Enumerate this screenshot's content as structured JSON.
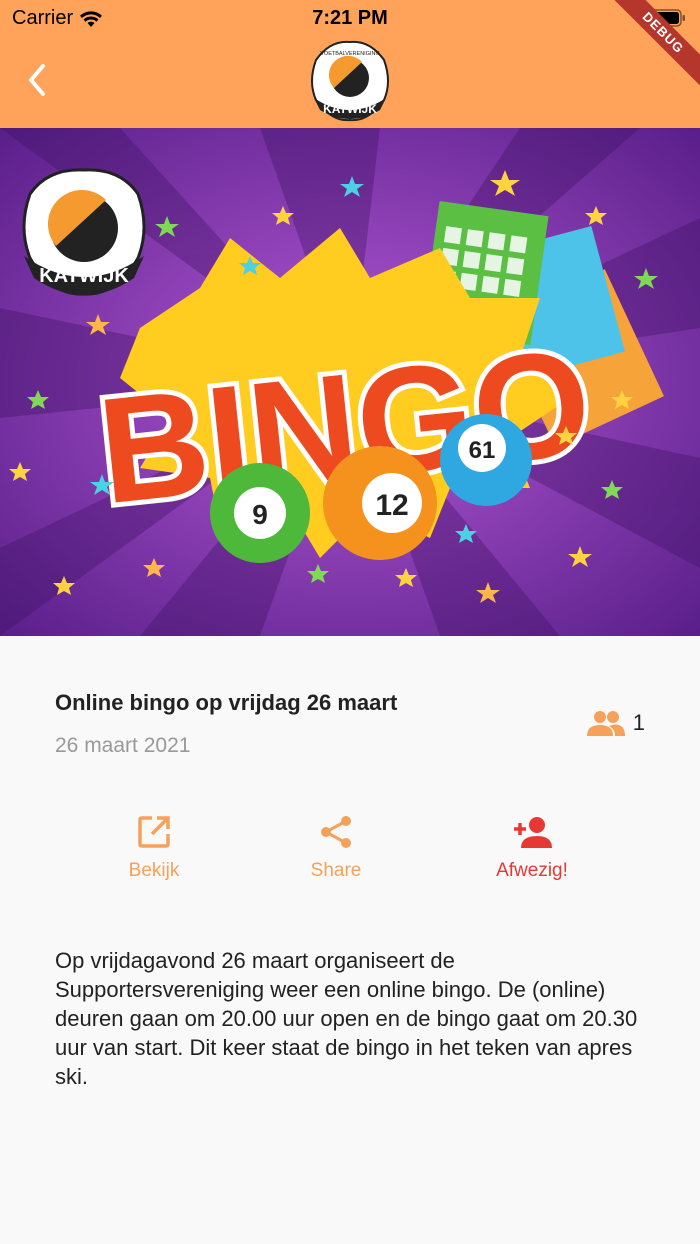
{
  "status_bar": {
    "carrier": "Carrier",
    "time": "7:21 PM"
  },
  "debug_banner": "DEBUG",
  "header": {
    "logo_text": "KATWIJK",
    "logo_subtext": "VOETBALVERENIGING"
  },
  "hero": {
    "headline": "BINGO",
    "logo_text": "KATWIJK",
    "ball_numbers": [
      "9",
      "12",
      "61"
    ]
  },
  "event": {
    "title": "Online bingo op vrijdag 26 maart",
    "date": "26 maart 2021",
    "attendee_count": "1"
  },
  "actions": {
    "view_label": "Bekijk",
    "share_label": "Share",
    "absent_label": "Afwezig!"
  },
  "description": "Op vrijdagavond 26 maart organiseert de Supportersvereniging weer een online bingo. De (online) deuren gaan om 20.00 uur open en de bingo gaat om 20.30 uur van start. Dit keer staat de bingo in het teken van apres ski.",
  "colors": {
    "app_bar": "#ffa35a",
    "accent": "#f5a15a",
    "alert": "#e53935",
    "hero_bg": "#7a2fa6"
  }
}
